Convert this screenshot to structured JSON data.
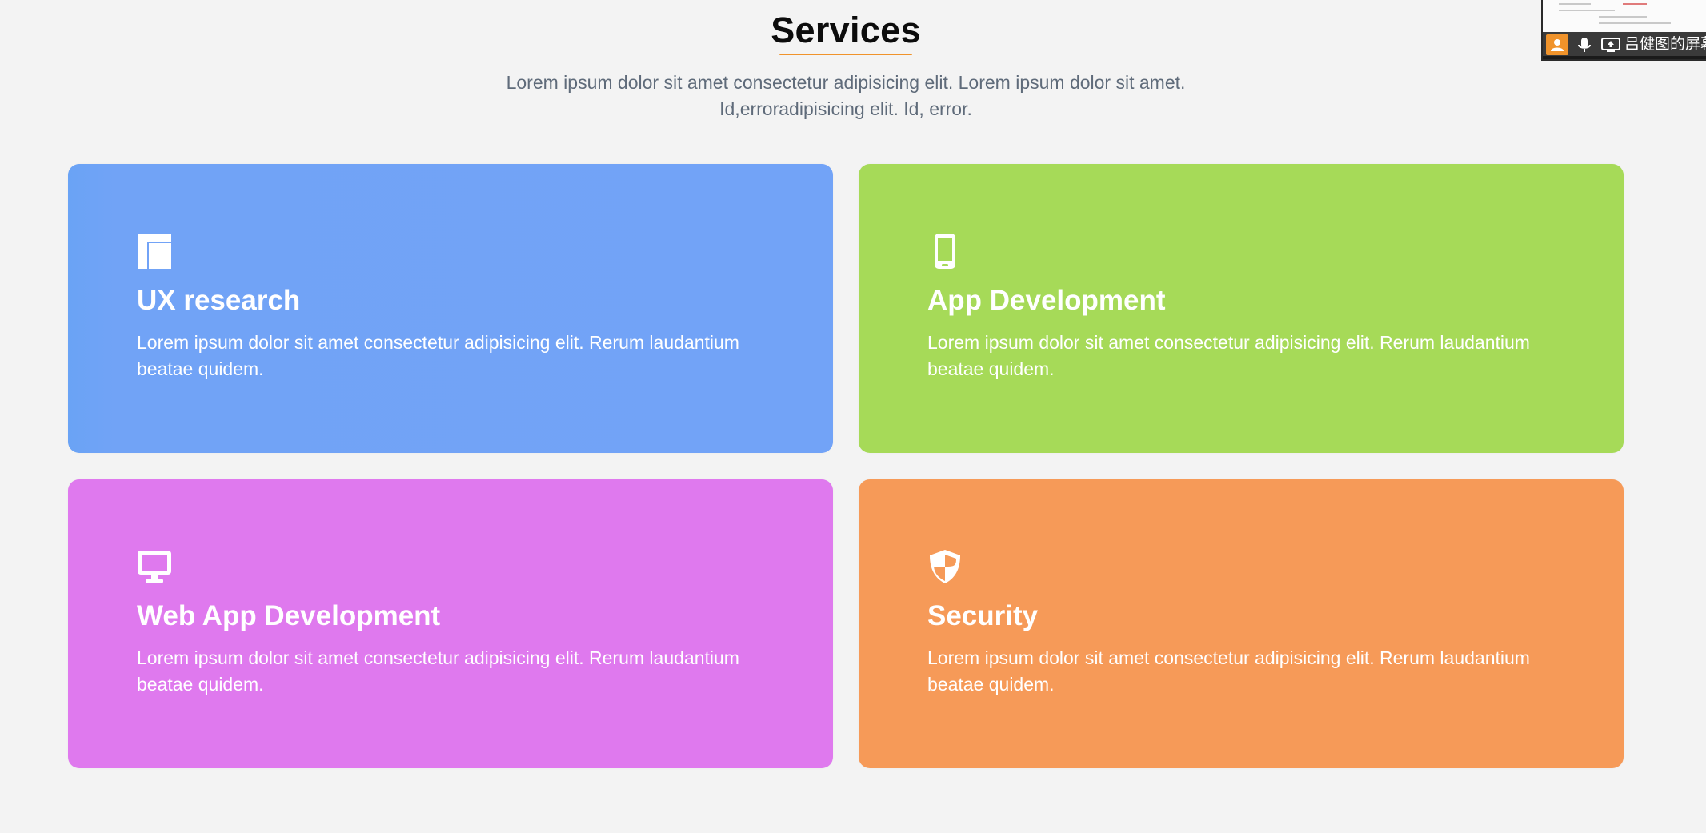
{
  "header": {
    "title": "Services",
    "subtitle": "Lorem ipsum dolor sit amet consectetur adipisicing elit. Lorem ipsum dolor sit amet. Id,erroradipisicing elit. Id, error."
  },
  "colors": {
    "background": "#f3f3f3",
    "accent": "#f0932b",
    "blue_card": "#72a3f7",
    "green_card": "#a6da58",
    "purple_card": "#df79ee",
    "orange_card": "#f69a58"
  },
  "cards": [
    {
      "icon": "layout-icon",
      "title": "UX research",
      "text": "Lorem ipsum dolor sit amet consectetur adipisicing elit. Rerum laudantium beatae quidem."
    },
    {
      "icon": "mobile-phone-icon",
      "title": "App Development",
      "text": "Lorem ipsum dolor sit amet consectetur adipisicing elit. Rerum laudantium beatae quidem."
    },
    {
      "icon": "desktop-monitor-icon",
      "title": "Web App Development",
      "text": "Lorem ipsum dolor sit amet consectetur adipisicing elit. Rerum laudantium beatae quidem."
    },
    {
      "icon": "shield-icon",
      "title": "Security",
      "text": "Lorem ipsum dolor sit amet consectetur adipisicing elit. Rerum laudantium beatae quidem."
    }
  ],
  "screen_share": {
    "presenter_name": "吕健图的屏幕"
  }
}
